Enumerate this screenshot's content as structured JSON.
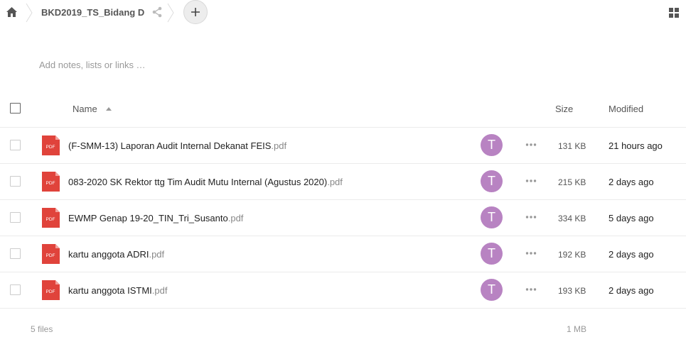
{
  "breadcrumb": {
    "folder": "BKD2019_TS_Bidang D"
  },
  "notes": {
    "placeholder": "Add notes, lists or links …"
  },
  "table": {
    "headers": {
      "name": "Name",
      "size": "Size",
      "modified": "Modified"
    },
    "rows": [
      {
        "name": "(F-SMM-13) Laporan Audit Internal Dekanat FEIS",
        "ext": ".pdf",
        "avatar": "T",
        "size": "131 KB",
        "modified": "21 hours ago"
      },
      {
        "name": "083-2020 SK Rektor ttg Tim Audit Mutu Internal (Agustus 2020)",
        "ext": ".pdf",
        "avatar": "T",
        "size": "215 KB",
        "modified": "2 days ago"
      },
      {
        "name": "EWMP Genap 19-20_TIN_Tri_Susanto",
        "ext": ".pdf",
        "avatar": "T",
        "size": "334 KB",
        "modified": "5 days ago"
      },
      {
        "name": "kartu anggota ADRI",
        "ext": ".pdf",
        "avatar": "T",
        "size": "192 KB",
        "modified": "2 days ago"
      },
      {
        "name": "kartu anggota ISTMI",
        "ext": ".pdf",
        "avatar": "T",
        "size": "193 KB",
        "modified": "2 days ago"
      }
    ],
    "pdf_icon_label": "PDF"
  },
  "footer": {
    "count": "5 files",
    "total_size": "1 MB"
  },
  "colors": {
    "pdf": "#e0433b",
    "avatar": "#b883c2"
  }
}
